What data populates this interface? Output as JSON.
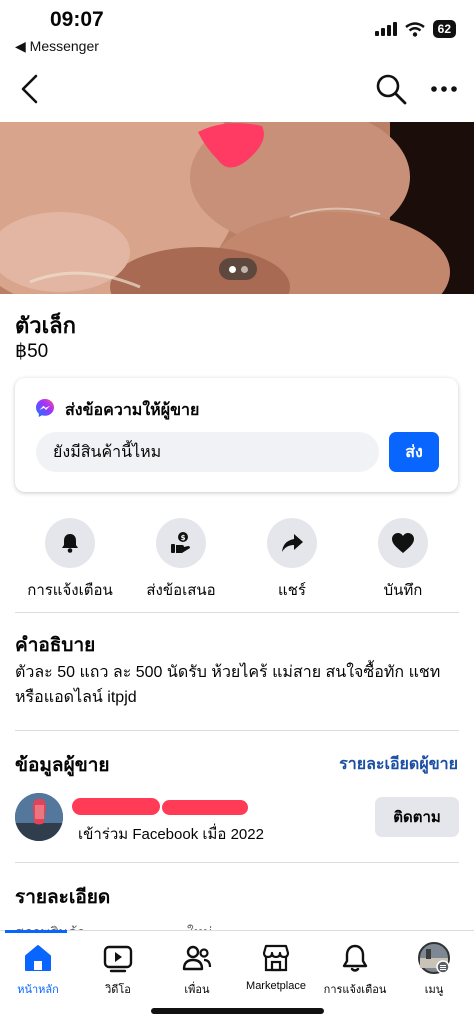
{
  "status_bar": {
    "time": "09:07",
    "back_app": "◀ Messenger",
    "battery": "62"
  },
  "listing": {
    "title": "ตัวเล็ก",
    "price": "฿50",
    "photo_count": 2,
    "photo_index": 1
  },
  "message_card": {
    "heading": "ส่งข้อความให้ผู้ขาย",
    "input_value": "ยังมีสินค้านี้ไหม",
    "send_label": "ส่ง"
  },
  "actions": [
    {
      "label": "การแจ้งเตือน",
      "icon": "bell-icon"
    },
    {
      "label": "ส่งข้อเสนอ",
      "icon": "offer-icon"
    },
    {
      "label": "แชร์",
      "icon": "share-icon"
    },
    {
      "label": "บันทึก",
      "icon": "heart-icon"
    }
  ],
  "description": {
    "title": "คำอธิบาย",
    "text": "ตัวละ 50 แถว ละ 500 นัดรับ ห้วยไคร้ แม่สาย สนใจซื้อทัก แชทหรือแอดไลน์ itpjd"
  },
  "seller": {
    "title": "ข้อมูลผู้ขาย",
    "details_link": "รายละเอียดผู้ขาย",
    "joined": "เข้าร่วม Facebook เมื่อ 2022",
    "follow_label": "ติดตาม"
  },
  "details": {
    "title": "รายละเอียด",
    "partial_left": "สภาพสินค้า",
    "partial_right": "ใหม่"
  },
  "tabs": [
    {
      "label": "หน้าหลัก",
      "icon": "home-icon",
      "active": true
    },
    {
      "label": "วิดีโอ",
      "icon": "video-icon",
      "active": false
    },
    {
      "label": "เพื่อน",
      "icon": "friends-icon",
      "active": false
    },
    {
      "label": "Marketplace",
      "icon": "marketplace-icon",
      "active": false
    },
    {
      "label": "การแจ้งเตือน",
      "icon": "bell-icon",
      "active": false
    },
    {
      "label": "เมนู",
      "icon": "menu-avatar-icon",
      "active": false
    }
  ],
  "colors": {
    "accent": "#0866ff",
    "link": "#1b4fa3",
    "redaction": "#ff3b55"
  }
}
